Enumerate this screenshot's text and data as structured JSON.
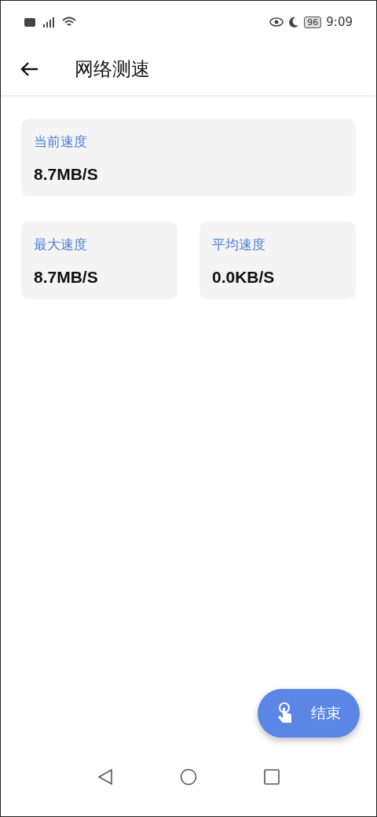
{
  "status_bar": {
    "battery": "96",
    "time": "9:09"
  },
  "app_bar": {
    "title": "网络测速"
  },
  "current": {
    "label": "当前速度",
    "value": "8.7MB/S"
  },
  "stats": [
    {
      "label": "最大速度",
      "value": "8.7MB/S"
    },
    {
      "label": "平均速度",
      "value": "0.0KB/S"
    }
  ],
  "fab": {
    "label": "结束"
  }
}
